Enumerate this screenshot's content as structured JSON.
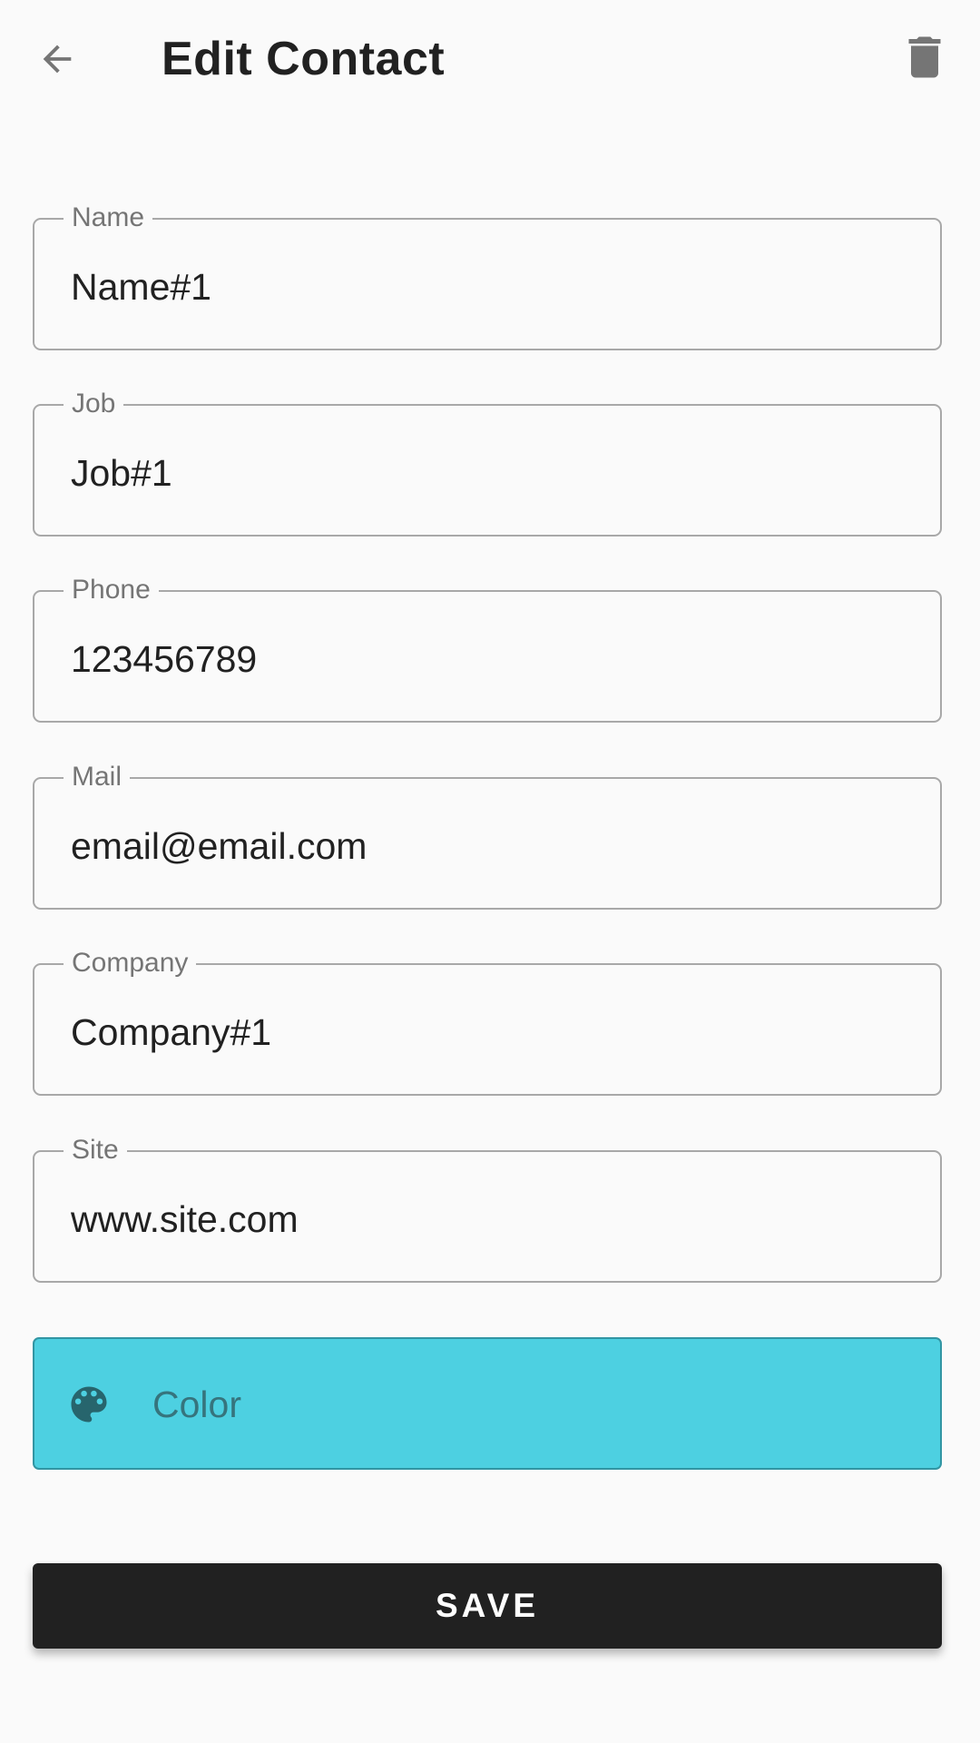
{
  "header": {
    "title": "Edit Contact",
    "back_icon": "arrow-back-icon",
    "delete_icon": "trash-icon"
  },
  "form": {
    "fields": [
      {
        "label": "Name",
        "value": "Name#1"
      },
      {
        "label": "Job",
        "value": "Job#1"
      },
      {
        "label": "Phone",
        "value": "123456789"
      },
      {
        "label": "Mail",
        "value": "email@email.com"
      },
      {
        "label": "Company",
        "value": "Company#1"
      },
      {
        "label": "Site",
        "value": "www.site.com"
      }
    ],
    "color_button": {
      "label": "Color",
      "icon": "palette-icon",
      "background": "#4dd0e1"
    },
    "save_label": "SAVE"
  },
  "colors": {
    "background": "#fafafa",
    "text": "#212121",
    "accent": "#4dd0e1",
    "save_button": "#212121"
  }
}
